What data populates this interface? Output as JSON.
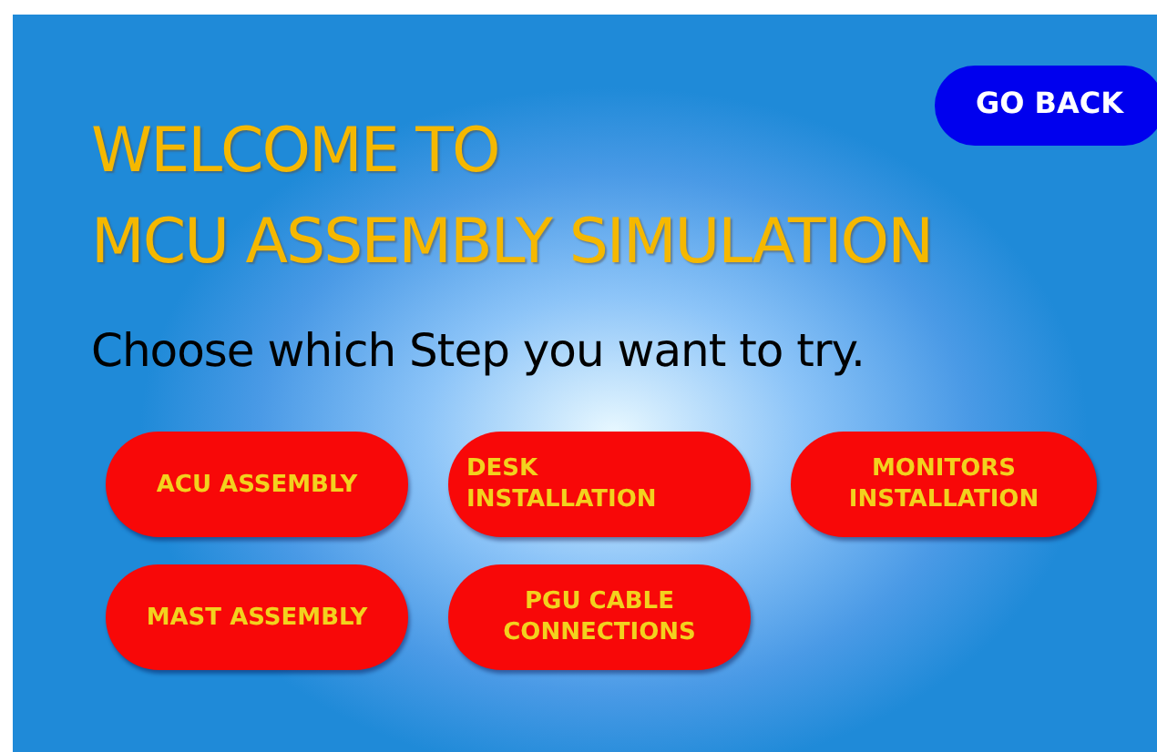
{
  "back_button": "GO BACK",
  "title_lines": [
    "WELCOME TO",
    "MCU ASSEMBLY SIMULATION"
  ],
  "prompt": "Choose which Step you want to try.",
  "steps": [
    {
      "lines": [
        "ACU ASSEMBLY"
      ]
    },
    {
      "lines": [
        "DESK INSTALLATION"
      ]
    },
    {
      "lines": [
        "MONITORS",
        "INSTALLATION"
      ]
    },
    {
      "lines": [
        "MAST ASSEMBLY"
      ]
    },
    {
      "lines": [
        "PGU CABLE",
        "CONNECTIONS"
      ]
    }
  ]
}
